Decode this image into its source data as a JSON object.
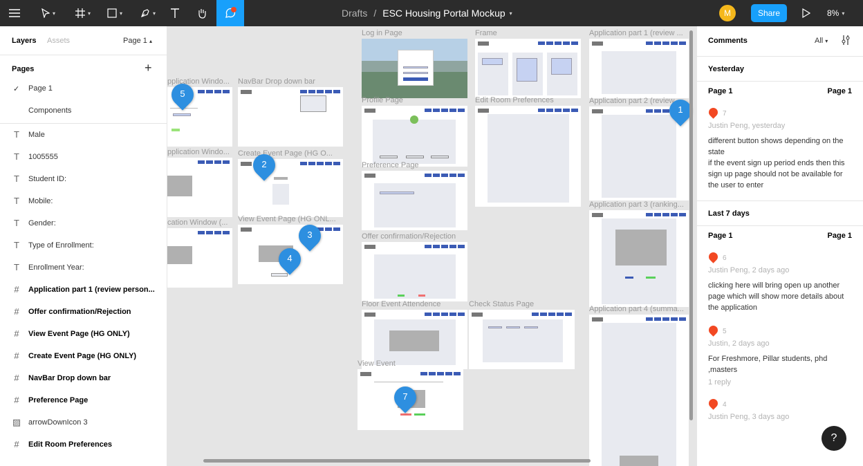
{
  "toolbar": {
    "breadcrumb": "Drafts",
    "separator": "/",
    "file_name": "ESC Housing Portal Mockup",
    "avatar_initial": "M",
    "share_label": "Share",
    "zoom": "8%"
  },
  "left_panel": {
    "tabs": {
      "layers": "Layers",
      "assets": "Assets",
      "page": "Page 1"
    },
    "pages_title": "Pages",
    "pages": [
      "Page 1",
      "Components"
    ],
    "layers": [
      {
        "type": "text",
        "name": "Male"
      },
      {
        "type": "text",
        "name": "1005555"
      },
      {
        "type": "text",
        "name": "Student ID:"
      },
      {
        "type": "text",
        "name": "Mobile:"
      },
      {
        "type": "text",
        "name": "Gender:"
      },
      {
        "type": "text",
        "name": "Type of Enrollment:"
      },
      {
        "type": "text",
        "name": "Enrollment Year:"
      },
      {
        "type": "frame",
        "name": "Application part 1 (review person..."
      },
      {
        "type": "frame",
        "name": "Offer confirmation/Rejection"
      },
      {
        "type": "frame",
        "name": "View Event Page (HG ONLY)"
      },
      {
        "type": "frame",
        "name": "Create Event Page (HG ONLY)"
      },
      {
        "type": "frame",
        "name": "NavBar Drop down bar"
      },
      {
        "type": "frame",
        "name": "Preference Page"
      },
      {
        "type": "image",
        "name": "arrowDownIcon 3"
      },
      {
        "type": "frame",
        "name": "Edit Room Preferences"
      }
    ]
  },
  "canvas": {
    "frames": [
      "Log in Page",
      "Frame",
      "Application part 1 (review ...",
      "pplication Windo...",
      "NavBar Drop down bar",
      "Profile Page",
      "Edit Room Preferences",
      "Application part 2 (review ...",
      "pplication Windo...",
      "Create Event Page (HG O...",
      "Preference Page",
      "cation Window (...",
      "View Event Page (HG ONL...",
      "Application part 3 (ranking...",
      "Offer confirmation/Rejection",
      "Floor Event Attendence",
      "Check Status Page",
      "Application part 4 (summa...",
      "View Event"
    ],
    "pins": [
      "5",
      "2",
      "3",
      "4",
      "7",
      "1"
    ]
  },
  "right_panel": {
    "title": "Comments",
    "filter": "All",
    "sections": [
      {
        "heading": "Yesterday",
        "page_left": "Page 1",
        "page_right": "Page 1",
        "comments": [
          {
            "num": "7",
            "author": "Justin Peng, yesterday",
            "text": "different button shows depending on the state\nif the event sign up period ends then this sign up page should not be available for the user to enter",
            "reply": ""
          }
        ]
      },
      {
        "heading": "Last 7 days",
        "page_left": "Page 1",
        "page_right": "Page 1",
        "comments": [
          {
            "num": "6",
            "author": "Justin Peng, 2 days ago",
            "text": "clicking here will bring open up another page which will show more details about the application",
            "reply": ""
          },
          {
            "num": "5",
            "author": "Justin, 2 days ago",
            "text": "For Freshmore, Pillar students, phd ,masters",
            "reply": "1 reply"
          },
          {
            "num": "4",
            "author": "Justin Peng, 3 days ago",
            "text": "",
            "reply": ""
          }
        ]
      }
    ],
    "help": "?"
  }
}
